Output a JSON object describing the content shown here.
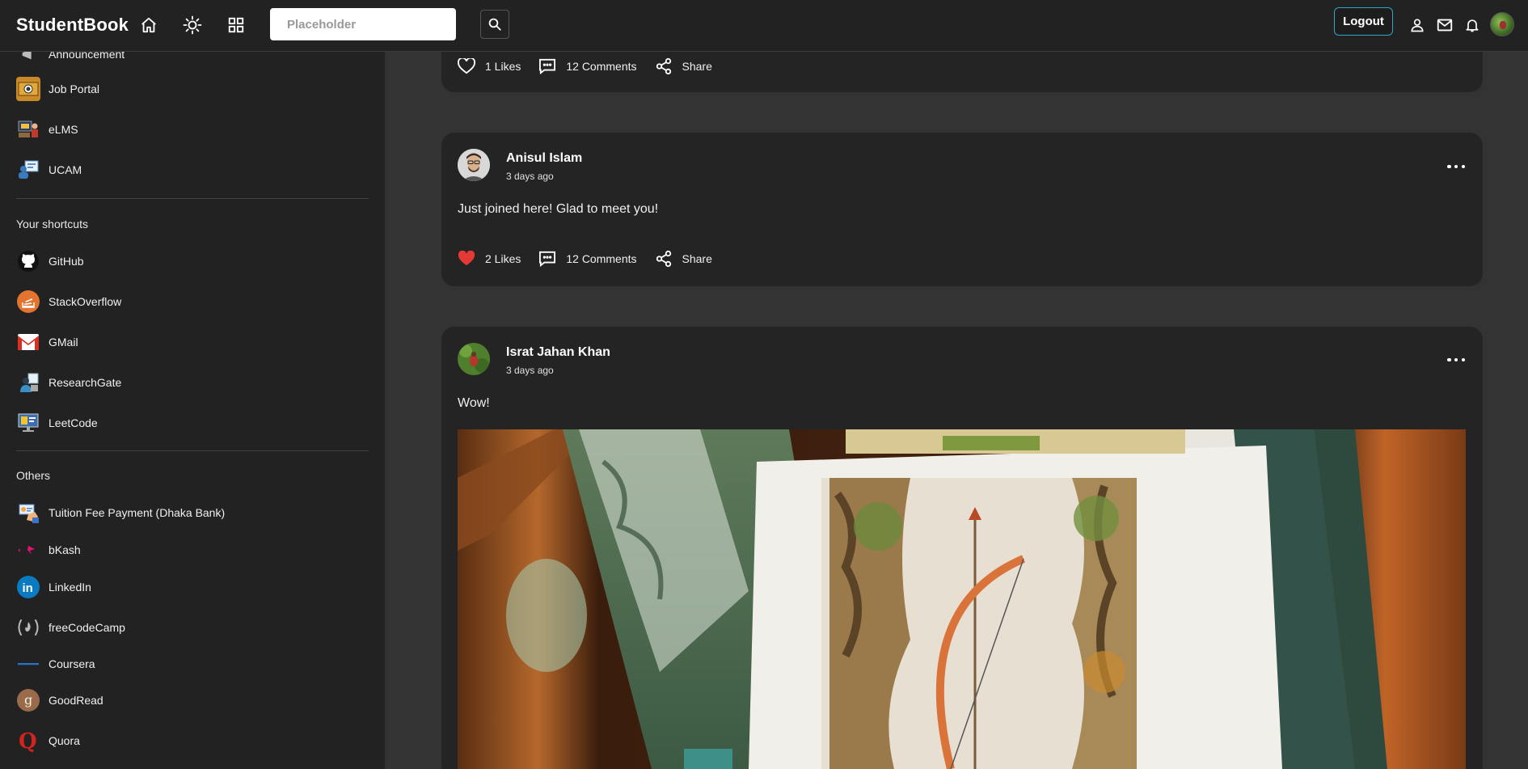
{
  "app": {
    "brand": "StudentBook"
  },
  "header": {
    "search_placeholder": "Placeholder",
    "logout_label": "Logout"
  },
  "sidebar": {
    "partial_item": "Announcement",
    "apps": [
      {
        "label": "Job Portal",
        "icon": "job-portal-icon"
      },
      {
        "label": "eLMS",
        "icon": "elms-icon"
      },
      {
        "label": "UCAM",
        "icon": "ucam-icon"
      }
    ],
    "shortcuts_heading": "Your shortcuts",
    "shortcuts": [
      {
        "label": "GitHub",
        "icon": "github-icon"
      },
      {
        "label": "StackOverflow",
        "icon": "stackoverflow-icon"
      },
      {
        "label": "GMail",
        "icon": "gmail-icon"
      },
      {
        "label": "ResearchGate",
        "icon": "researchgate-icon"
      },
      {
        "label": "LeetCode",
        "icon": "leetcode-icon"
      }
    ],
    "others_heading": "Others",
    "others": [
      {
        "label": "Tuition Fee Payment (Dhaka Bank)",
        "icon": "payment-icon"
      },
      {
        "label": "bKash",
        "icon": "bkash-icon"
      },
      {
        "label": "LinkedIn",
        "icon": "linkedin-icon"
      },
      {
        "label": "freeCodeCamp",
        "icon": "freecodecamp-icon"
      },
      {
        "label": "Coursera",
        "icon": "coursera-icon"
      },
      {
        "label": "GoodRead",
        "icon": "goodread-icon"
      },
      {
        "label": "Quora",
        "icon": "quora-icon"
      }
    ]
  },
  "posts": [
    {
      "likes": "1 Likes",
      "comments": "12 Comments",
      "share": "Share",
      "liked": false
    },
    {
      "author": "Anisul Islam",
      "time": "3 days ago",
      "text": "Just joined here! Glad to meet you!",
      "likes": "2 Likes",
      "comments": "12 Comments",
      "share": "Share",
      "liked": true
    },
    {
      "author": "Israt Jahan Khan",
      "time": "3 days ago",
      "text": "Wow!",
      "image": "tarot-cards-photo"
    }
  ],
  "colors": {
    "page_bg": "#333333",
    "panel_bg": "#222222",
    "card_bg": "#242424",
    "logout_border": "#2fa6c7",
    "like_red": "#e53935"
  }
}
